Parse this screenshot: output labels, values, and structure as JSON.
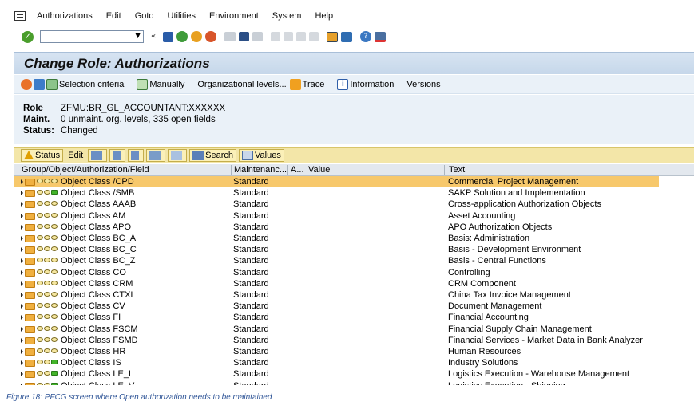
{
  "menu": [
    "Authorizations",
    "Edit",
    "Goto",
    "Utilities",
    "Environment",
    "System",
    "Help"
  ],
  "title": "Change Role: Authorizations",
  "app_toolbar": {
    "selection_criteria": "Selection criteria",
    "manually": "Manually",
    "org_levels": "Organizational levels...",
    "trace": "Trace",
    "information": "Information",
    "versions": "Versions"
  },
  "header": {
    "role_label": "Role",
    "role_value": "ZFMU:BR_GL_ACCOUNTANT:XXXXXX",
    "maint_label": "Maint.",
    "maint_value": "0 unmaint. org. levels, 335 open fields",
    "status_label": "Status:",
    "status_value": "Changed"
  },
  "tree_toolbar": {
    "status": "Status",
    "edit": "Edit",
    "search": "Search",
    "values": "Values"
  },
  "columns": {
    "group": "Group/Object/Authorization/Field",
    "maintenance": "Maintenanc...",
    "a": "A...",
    "value": "Value",
    "text": "Text"
  },
  "rows": [
    {
      "name": "Object Class /CPD",
      "maint": "Standard",
      "text": "Commercial Project Management",
      "green": false
    },
    {
      "name": "Object Class /SMB",
      "maint": "Standard",
      "text": "SAKP Solution and Implementation",
      "green": true
    },
    {
      "name": "Object Class AAAB",
      "maint": "Standard",
      "text": "Cross-application Authorization Objects",
      "green": false
    },
    {
      "name": "Object Class AM",
      "maint": "Standard",
      "text": "Asset Accounting",
      "green": false
    },
    {
      "name": "Object Class APO",
      "maint": "Standard",
      "text": "APO Authorization Objects",
      "green": false
    },
    {
      "name": "Object Class BC_A",
      "maint": "Standard",
      "text": "Basis: Administration",
      "green": false
    },
    {
      "name": "Object Class BC_C",
      "maint": "Standard",
      "text": "Basis - Development Environment",
      "green": false
    },
    {
      "name": "Object Class BC_Z",
      "maint": "Standard",
      "text": "Basis - Central Functions",
      "green": false
    },
    {
      "name": "Object Class CO",
      "maint": "Standard",
      "text": "Controlling",
      "green": false
    },
    {
      "name": "Object Class CRM",
      "maint": "Standard",
      "text": "CRM Component",
      "green": false
    },
    {
      "name": "Object Class CTXI",
      "maint": "Standard",
      "text": "China Tax Invoice Management",
      "green": false
    },
    {
      "name": "Object Class CV",
      "maint": "Standard",
      "text": "Document Management",
      "green": false
    },
    {
      "name": "Object Class FI",
      "maint": "Standard",
      "text": "Financial Accounting",
      "green": false
    },
    {
      "name": "Object Class FSCM",
      "maint": "Standard",
      "text": "Financial Supply Chain Management",
      "green": false
    },
    {
      "name": "Object Class FSMD",
      "maint": "Standard",
      "text": "Financial Services - Market Data in Bank Analyzer",
      "green": false
    },
    {
      "name": "Object Class HR",
      "maint": "Standard",
      "text": "Human Resources",
      "green": false
    },
    {
      "name": "Object Class IS",
      "maint": "Standard",
      "text": "Industry Solutions",
      "green": true
    },
    {
      "name": "Object Class LE_L",
      "maint": "Standard",
      "text": "Logistics Execution - Warehouse Management",
      "green": true
    },
    {
      "name": "Object Class LE_V",
      "maint": "Standard",
      "text": "Logistics Execution - Shipping",
      "green": true
    }
  ],
  "caption": "Figure 18: PFCG screen where Open authorization needs to be maintained"
}
